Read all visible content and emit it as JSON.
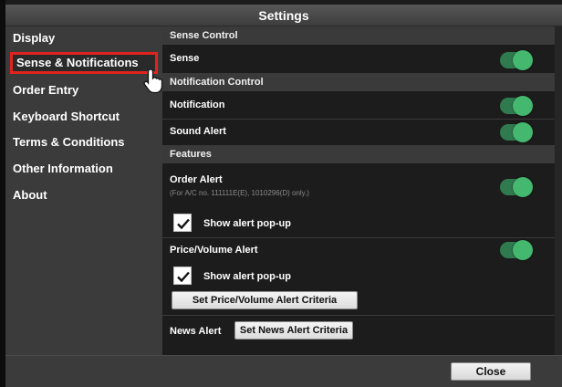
{
  "window": {
    "title": "Settings"
  },
  "sidebar": {
    "items": [
      {
        "label": "Display",
        "selected": false
      },
      {
        "label": "Sense & Notifications",
        "selected": true
      },
      {
        "label": "Order Entry",
        "selected": false
      },
      {
        "label": "Keyboard Shortcut",
        "selected": false
      },
      {
        "label": "Terms & Conditions",
        "selected": false
      },
      {
        "label": "Other Information",
        "selected": false
      },
      {
        "label": "About",
        "selected": false
      }
    ]
  },
  "sense_control": {
    "header": "Sense Control",
    "sense": {
      "label": "Sense",
      "on": true
    }
  },
  "notification_control": {
    "header": "Notification Control",
    "notification": {
      "label": "Notification",
      "on": true
    },
    "sound_alert": {
      "label": "Sound Alert",
      "on": true
    }
  },
  "features": {
    "header": "Features",
    "order_alert": {
      "label": "Order Alert",
      "note": "(For A/C no. 111111E(E), 1010296(D) only.)",
      "on": true,
      "popup": {
        "label": "Show alert pop-up",
        "checked": true
      }
    },
    "price_volume_alert": {
      "label": "Price/Volume Alert",
      "on": true,
      "popup": {
        "label": "Show alert pop-up",
        "checked": true
      },
      "criteria_button": "Set Price/Volume Alert Criteria"
    },
    "news_alert": {
      "label": "News Alert",
      "criteria_button": "Set News Alert Criteria"
    }
  },
  "footer": {
    "close_label": "Close"
  },
  "colors": {
    "toggle_on": "#45b86f",
    "selection_outline": "#e0231e",
    "sidebar_bg": "#3b3b3b",
    "content_bg": "#1c1c1c"
  }
}
